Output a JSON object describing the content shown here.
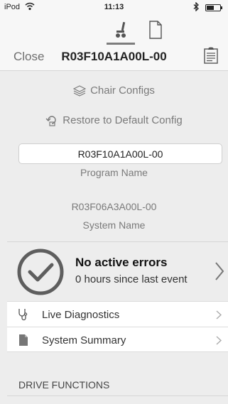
{
  "status": {
    "carrier": "iPod",
    "time": "11:13"
  },
  "header": {
    "close_label": "Close",
    "title": "R03F10A1A00L-00"
  },
  "config": {
    "chair_configs_label": "Chair Configs",
    "restore_label": "Restore to Default Config",
    "program_value": "R03F10A1A00L-00",
    "program_caption": "Program Name",
    "system_value": "R03F06A3A00L-00",
    "system_caption": "System Name"
  },
  "errors": {
    "title": "No active errors",
    "subtitle": "0 hours since last event"
  },
  "list": {
    "items": [
      {
        "label": "Live Diagnostics",
        "icon": "stethoscope-icon"
      },
      {
        "label": "System Summary",
        "icon": "document-icon"
      }
    ]
  },
  "section": {
    "title": "DRIVE FUNCTIONS"
  }
}
